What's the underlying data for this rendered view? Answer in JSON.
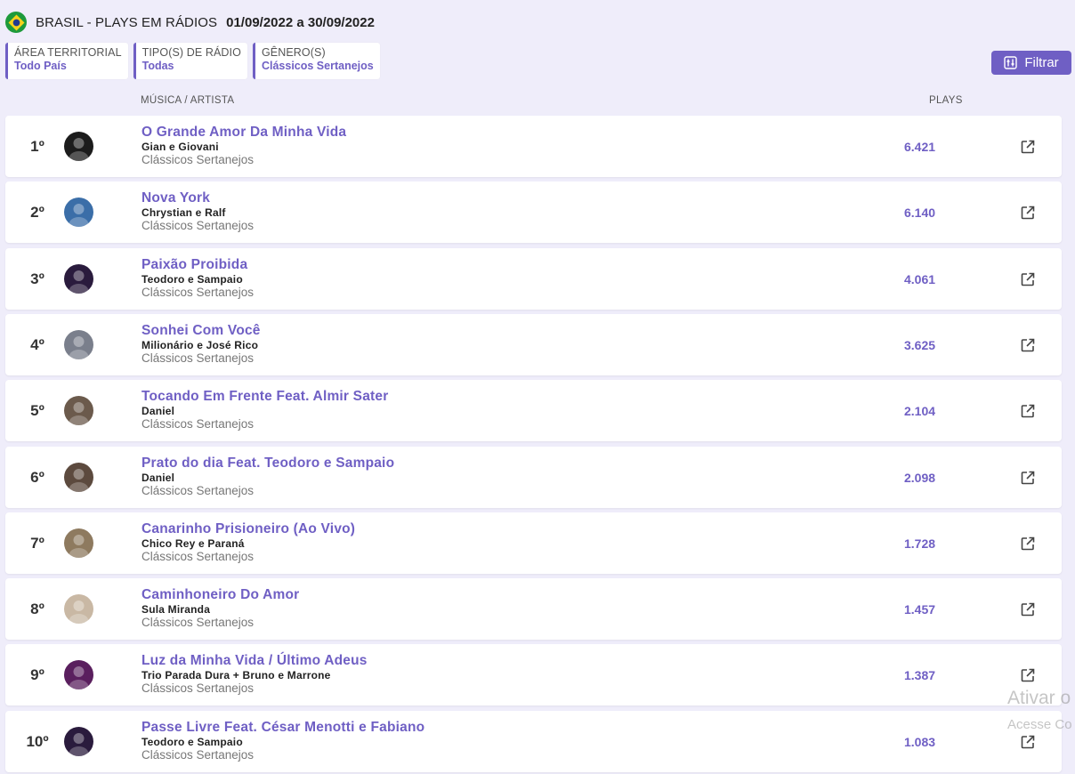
{
  "header": {
    "title": "BRASIL - PLAYS EM RÁDIOS",
    "period": "01/09/2022 a 30/09/2022",
    "flag_icon": "brazil-flag-icon"
  },
  "filters": [
    {
      "label": "ÁREA TERRITORIAL",
      "value": "Todo País"
    },
    {
      "label": "TIPO(S) DE RÁDIO",
      "value": "Todas"
    },
    {
      "label": "GÊNERO(S)",
      "value": "Clássicos Sertanejos"
    }
  ],
  "filter_button": {
    "label": "Filtrar",
    "icon": "filter-sliders-icon"
  },
  "columns": {
    "music_artist": "MÚSICA / ARTISTA",
    "plays": "PLAYS"
  },
  "colors": {
    "accent": "#6f5fc4",
    "background": "#efedfa"
  },
  "rows": [
    {
      "rank": "1º",
      "song": "O Grande Amor Da Minha Vida",
      "artist": "Gian e Giovani",
      "genre": "Clássicos Sertanejos",
      "plays": "6.421",
      "avatar_color": "#1c1c1c"
    },
    {
      "rank": "2º",
      "song": "Nova York",
      "artist": "Chrystian e Ralf",
      "genre": "Clássicos Sertanejos",
      "plays": "6.140",
      "avatar_color": "#3b6ea8"
    },
    {
      "rank": "3º",
      "song": "Paixão Proibida",
      "artist": "Teodoro e Sampaio",
      "genre": "Clássicos Sertanejos",
      "plays": "4.061",
      "avatar_color": "#2a1b3d"
    },
    {
      "rank": "4º",
      "song": "Sonhei Com Você",
      "artist": "Milionário e José Rico",
      "genre": "Clássicos Sertanejos",
      "plays": "3.625",
      "avatar_color": "#7a7f8c"
    },
    {
      "rank": "5º",
      "song": "Tocando Em Frente Feat. Almir Sater",
      "artist": "Daniel",
      "genre": "Clássicos Sertanejos",
      "plays": "2.104",
      "avatar_color": "#6b5a4c"
    },
    {
      "rank": "6º",
      "song": "Prato do dia Feat. Teodoro e Sampaio",
      "artist": "Daniel",
      "genre": "Clássicos Sertanejos",
      "plays": "2.098",
      "avatar_color": "#5c4a3e"
    },
    {
      "rank": "7º",
      "song": "Canarinho Prisioneiro (Ao Vivo)",
      "artist": "Chico Rey e Paraná",
      "genre": "Clássicos Sertanejos",
      "plays": "1.728",
      "avatar_color": "#8e7a5f"
    },
    {
      "rank": "8º",
      "song": "Caminhoneiro Do Amor",
      "artist": "Sula Miranda",
      "genre": "Clássicos Sertanejos",
      "plays": "1.457",
      "avatar_color": "#c9b8a4"
    },
    {
      "rank": "9º",
      "song": "Luz da Minha Vida / Último Adeus",
      "artist": "Trio Parada Dura + Bruno e Marrone",
      "genre": "Clássicos Sertanejos",
      "plays": "1.387",
      "avatar_color": "#5a1f5e"
    },
    {
      "rank": "10º",
      "song": "Passe Livre Feat. César Menotti e Fabiano",
      "artist": "Teodoro e Sampaio",
      "genre": "Clássicos Sertanejos",
      "plays": "1.083",
      "avatar_color": "#2a1b3d"
    }
  ],
  "watermark": {
    "line1": "Ativar o",
    "line2": "Acesse Co"
  }
}
